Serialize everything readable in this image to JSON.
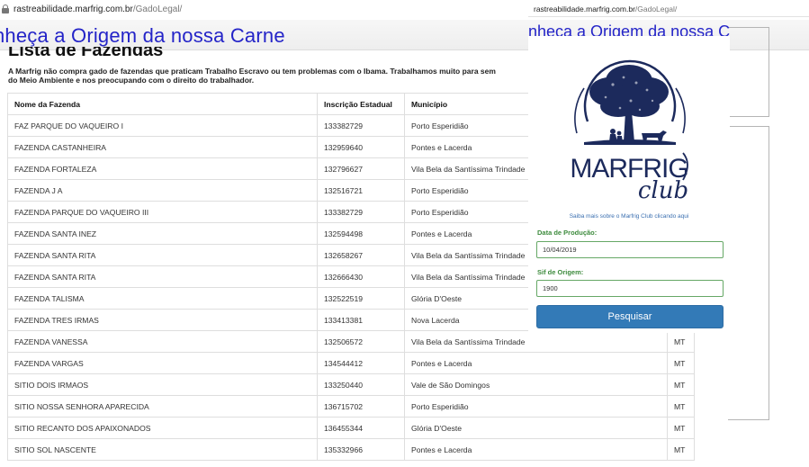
{
  "left": {
    "url": {
      "host": "rastreabilidade.marfrig.com.br",
      "path": "/GadoLegal/"
    },
    "site_title": "nheça a Origem da nossa Carne",
    "list_heading": "Lista de Fazendas",
    "intro_line1": "A Marfrig não compra gado de fazendas que praticam Trabalho Escravo ou tem problemas com o Ibama. Trabalhamos muito para sem",
    "intro_line2": "do Meio Ambiente e nos preocupando com o direito do trabalhador.",
    "columns": [
      "Nome da Fazenda",
      "Inscrição Estadual",
      "Município",
      ""
    ],
    "rows": [
      [
        "FAZ PARQUE DO VAQUEIRO I",
        "133382729",
        "Porto Esperidião",
        ""
      ],
      [
        "FAZENDA CASTANHEIRA",
        "132959640",
        "Pontes e Lacerda",
        ""
      ],
      [
        "FAZENDA FORTALEZA",
        "132796627",
        "Vila Bela da Santíssima Trindade",
        ""
      ],
      [
        "FAZENDA J A",
        "132516721",
        "Porto Esperidião",
        ""
      ],
      [
        "FAZENDA PARQUE DO VAQUEIRO III",
        "133382729",
        "Porto Esperidião",
        ""
      ],
      [
        "FAZENDA SANTA INEZ",
        "132594498",
        "Pontes e Lacerda",
        ""
      ],
      [
        "FAZENDA SANTA RITA",
        "132658267",
        "Vila Bela da Santíssima Trindade",
        ""
      ],
      [
        "FAZENDA SANTA RITA",
        "132666430",
        "Vila Bela da Santíssima Trindade",
        ""
      ],
      [
        "FAZENDA TALISMA",
        "132522519",
        "Glória D'Oeste",
        ""
      ],
      [
        "FAZENDA TRES IRMAS",
        "133413381",
        "Nova Lacerda",
        ""
      ],
      [
        "FAZENDA VANESSA",
        "132506572",
        "Vila Bela da Santíssima Trindade",
        "MT"
      ],
      [
        "FAZENDA VARGAS",
        "134544412",
        "Pontes e Lacerda",
        "MT"
      ],
      [
        "SITIO DOIS IRMAOS",
        "133250440",
        "Vale de São Domingos",
        "MT"
      ],
      [
        "SITIO NOSSA SENHORA APARECIDA",
        "136715702",
        "Porto Esperidião",
        "MT"
      ],
      [
        "SITIO RECANTO DOS APAIXONADOS",
        "136455344",
        "Glória D'Oeste",
        "MT"
      ],
      [
        "SITIO SOL NASCENTE",
        "135332966",
        "Pontes e Lacerda",
        "MT"
      ]
    ]
  },
  "right": {
    "url": {
      "host": "rastreabilidade.marfrig.com.br",
      "path": "/GadoLegal/"
    },
    "title": "nheça a Origem da nossa C",
    "logo_main": "MARFRIG",
    "logo_script": "club",
    "club_link": "Saiba mais sobre o Marfrig Club clicando aqui",
    "production_label": "Data de Produção:",
    "production_value": "10/04/2019",
    "sif_label": "Sif de Origem:",
    "sif_value": "1900",
    "search_label": "Pesquisar",
    "colors": {
      "accent": "#337ab7",
      "label_green": "#3d8b3d",
      "title_blue": "#2424c8",
      "logo_navy": "#1c2a5c"
    }
  }
}
